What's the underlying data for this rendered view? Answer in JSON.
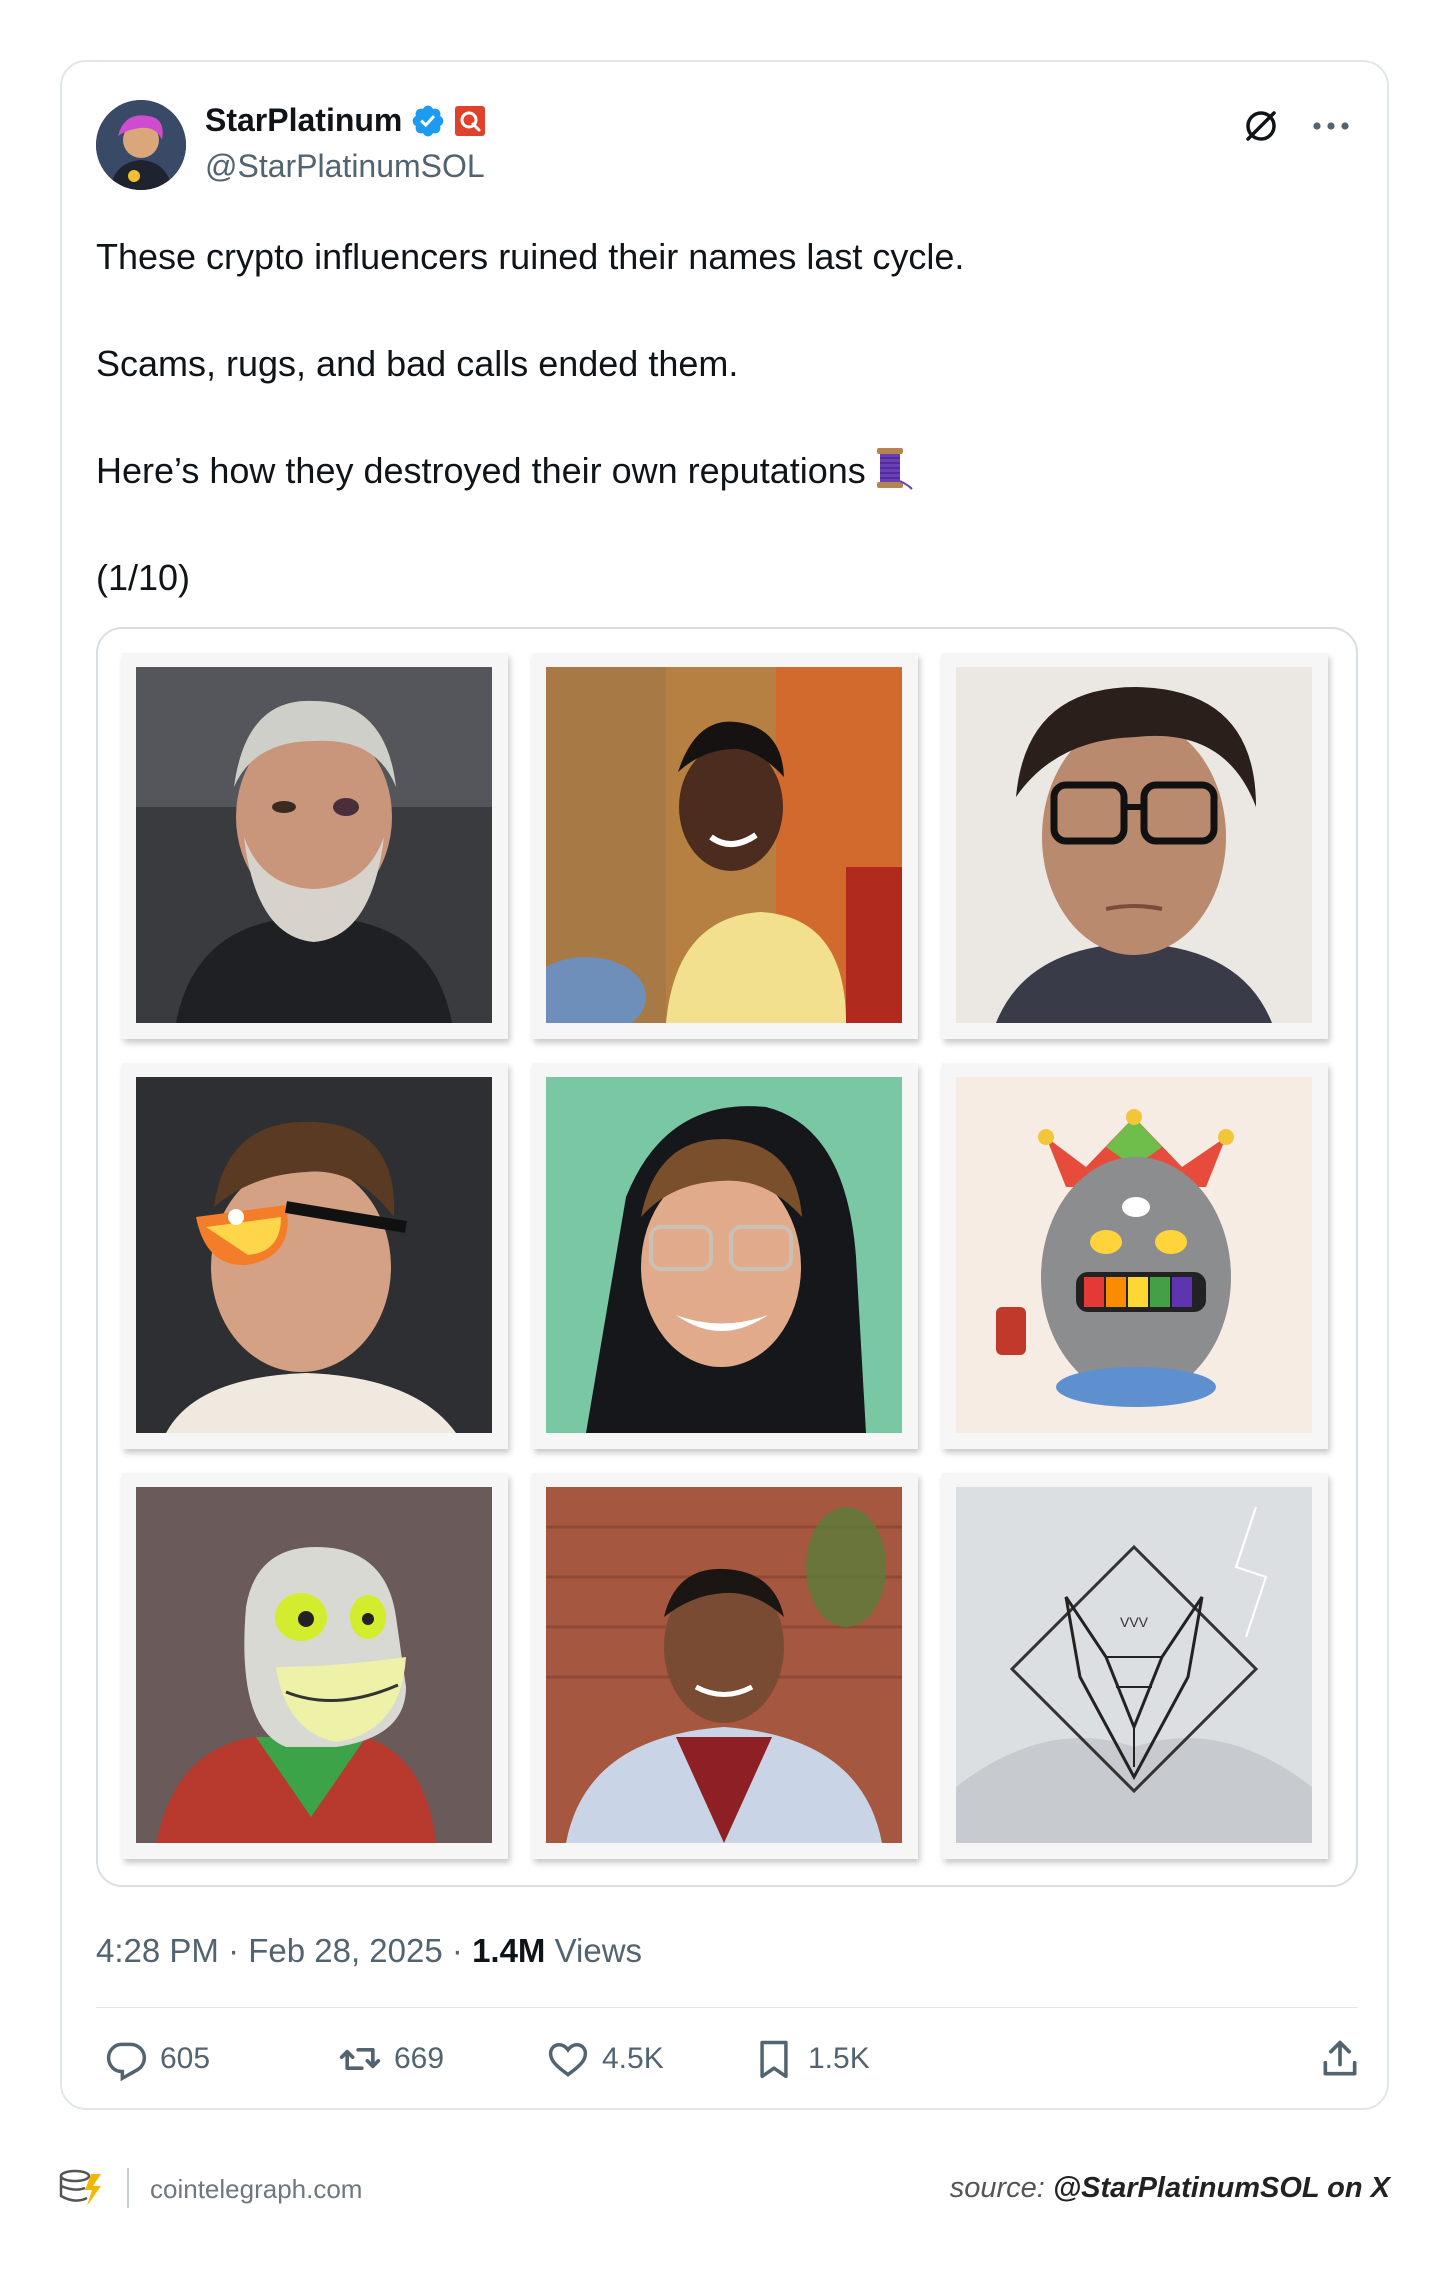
{
  "author": {
    "name": "StarPlatinum",
    "handle": "@StarPlatinumSOL"
  },
  "top_icons": [
    "grok-icon",
    "more-icon"
  ],
  "tweet": {
    "paragraphs": [
      "These crypto influencers ruined their names last cycle.",
      "Scams, rugs, and bad calls ended them.",
      "Here’s how they destroyed their own reputations",
      "(1/10)"
    ],
    "thread_emoji": "thread-spool-icon"
  },
  "media": {
    "tiles": [
      "portrait-grey-beard",
      "portrait-yellow-shirt",
      "portrait-glasses",
      "portrait-sunglasses",
      "portrait-hoodie",
      "nft-jester-egg",
      "nft-lizard",
      "portrait-red-shirt",
      "logo-wolf"
    ]
  },
  "meta": {
    "time": "4:28 PM",
    "sep1": " · ",
    "date": "Feb 28, 2025",
    "sep2": " · ",
    "views_count": "1.4M",
    "views_label": " Views"
  },
  "actions": {
    "replies": "605",
    "reposts": "669",
    "likes": "4.5K",
    "bookmarks": "1.5K"
  },
  "footer": {
    "site": "cointelegraph.com",
    "source_label": "source: ",
    "source_value": "@StarPlatinumSOL on X"
  },
  "colors": {
    "verified": "#1d9bf0",
    "org_badge": "#e0412c",
    "text": "#0f1419",
    "muted": "#536471"
  }
}
